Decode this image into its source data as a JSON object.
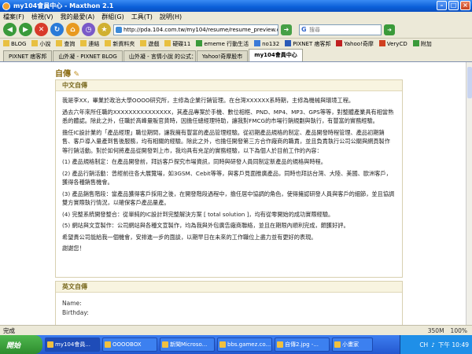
{
  "window": {
    "title": "my104會員中心 - Maxthon 2.1"
  },
  "menu": [
    "檔案(F)",
    "檢視(V)",
    "我的最愛(A)",
    "群組(G)",
    "工具(T)",
    "說明(H)"
  ],
  "toolbar": {
    "address": "http://pda.104.com.tw/my104/resume/resume_preview.cfm?pz=1&p=2",
    "search_placeholder": "搜尋"
  },
  "bookmarks": [
    "BLOG",
    "小說",
    "查詢",
    "連結",
    "新資料夾",
    "遊戲",
    "硬碟11",
    "ememe 行動生活",
    "no132",
    "PIXNET 痞客邦",
    "Yahoo!奇摩",
    "VeryCD",
    "附加"
  ],
  "tabs": [
    {
      "label": "PIXNET 痞客邦",
      "active": false
    },
    {
      "label": "山外凝 - PIXNET BLOG",
      "active": false
    },
    {
      "label": "山外凝 - 言情小說 的公式：PI...",
      "active": false
    },
    {
      "label": "Yahoo!奇摩股市",
      "active": false
    },
    {
      "label": "my104會員中心",
      "active": true
    }
  ],
  "page": {
    "heading": "自傳",
    "chinese_title": "中文自傳",
    "paragraphs": [
      "我是李XX，畢業於政治大學OOOO研究所，主修為企業行銷管理。在台灣XXXXXX系時期，主修為機械與環境工程。",
      "過去六年來所任職的XXXXXXXXXXXXXXX，其產品專案於手機、數位相框、PND、MP4、MP3、GPS等等，對整體產業具有相當熟悉的體認。除此之外，任職於高峰量販官貨時，因擔任總經理特助，讓我對FMCG的市場行銷規劃與執行，有豐富的實務經驗。",
      "擔任IC設計業的「產品經理」職位期間，讓我擁有豐富的產品管理經驗。從初期產品規格的制定、產品開發時程管理、產品初期銷售、客戶導入量產到售後服務，均有相關的經驗。除此之外，也擔任開發第三方合作廠商的職責，並且負責執行公司公關與網頁製作等行銷活動。對於如何將產品從開發到上市，我均具有充足的實務經驗，以下為個人於目前工作的內容：",
      "(1) 產品規格制定：在產品開發前，拜訪客戶探究市場資訊，同時與研發人員同制定新產品的規格與時程。",
      "(2) 產品行銷活動：曾經前往各大展覽場，如3GSM、Cebit等等，與客戶見面推廣產品，同時也拜訪台灣、大陸、美國、歐洲客戶，獲得各種銷售機會。",
      "(3) 產品銷售階段：當產品獲得客戶採用之後，在開發階段過程中，擔任居中協調的角色，使得擁認研發人員與客戶的細節，並且協調雙方實際執行情況，以確保客戶產品量產。",
      "(4) 完整系統開發整合：從單純的IC設計到完整解決方案 [ total solution ]，均有從零開始的成功實際經驗。",
      "(5) 網站與文宣製作：公司網站與各種文宣製作，均為我與外包廣告廠商聯絡，並且在期限內順利完成，頗獲好評。",
      "希望貴公司能給我一個機會，安排進一步的面談，以期早日在未來的工作職位上盡力並有更好的表現。",
      "謝謝您！"
    ],
    "english_title": "英文自傳",
    "name_label": "Name:",
    "birthday_label": "Birthday:"
  },
  "status": {
    "text": "完成",
    "mem": "350M",
    "zoom": "100%"
  },
  "taskbar": {
    "start": "開始",
    "tasks": [
      "my104會員...",
      "OOOOBOX",
      "新聞Microso...",
      "bbs.gamez.co...",
      "自傳2.jpg -...",
      "小畫家"
    ],
    "active_index": 0,
    "lang": "CH",
    "clock": "下午 10:49"
  }
}
